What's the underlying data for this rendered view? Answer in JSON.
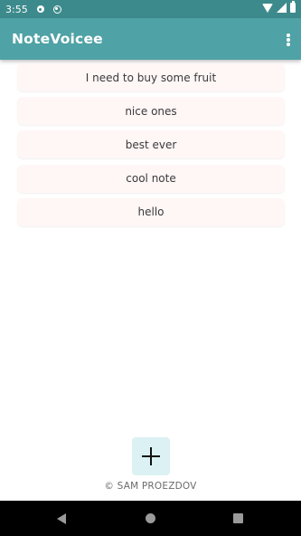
{
  "status_bar": {
    "time": "3:55",
    "icons": [
      "settings-icon",
      "sync-icon",
      "wifi-icon",
      "signal-icon",
      "battery-icon"
    ]
  },
  "app_bar": {
    "title": "NoteVoicee",
    "menu_icon": "overflow-menu-icon"
  },
  "notes": [
    "I need to buy some fruit",
    "nice ones",
    "best ever",
    "cool note",
    "hello"
  ],
  "fab": {
    "icon": "plus-icon"
  },
  "footer": {
    "text": "© SAM PROEZDOV"
  },
  "nav_bar": {
    "icons": [
      "back-icon",
      "home-icon",
      "recents-icon"
    ]
  },
  "colors": {
    "status_bar": "#3d8a8c",
    "app_bar": "#4fa2a5",
    "note_background": "#fff6f6",
    "fab_background": "#dbf1f3",
    "nav_bar": "#000000"
  }
}
